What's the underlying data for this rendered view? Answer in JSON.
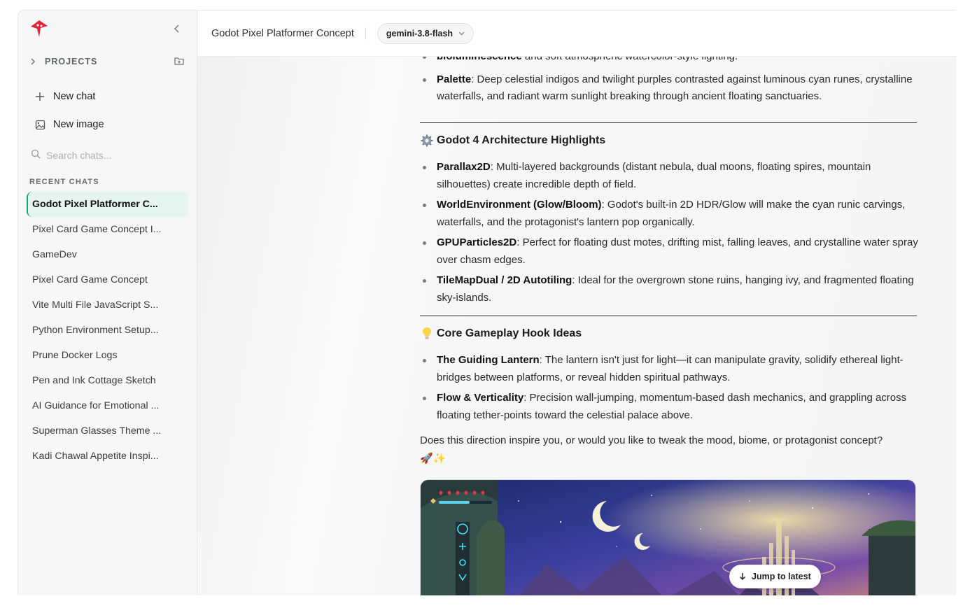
{
  "app": {
    "brand_color": "#e0253a",
    "accent": "#1aa37a"
  },
  "sidebar": {
    "projects_label": "PROJECTS",
    "new_chat": "New chat",
    "new_image": "New image",
    "search_placeholder": "Search chats...",
    "recent_label": "RECENT CHATS",
    "chats": [
      "Godot Pixel Platformer C...",
      "Pixel Card Game Concept I...",
      "GameDev",
      "Pixel Card Game Concept",
      "Vite Multi File JavaScript S...",
      "Python Environment Setup...",
      "Prune Docker Logs",
      "Pen and Ink Cottage Sketch",
      "AI Guidance for Emotional ...",
      "Superman Glasses Theme ...",
      "Kadi Chawal Appetite Inspi..."
    ]
  },
  "header": {
    "title": "Godot Pixel Platformer Concept",
    "model": "gemini-3.8-flash"
  },
  "message": {
    "cut_top_bold": "bioluminescence",
    "cut_top_rest": " and soft atmospheric watercolor-style lighting.",
    "palette_bold": "Palette",
    "palette_text": ": Deep celestial indigos and twilight purples contrasted against luminous cyan runes, crystalline waterfalls, and radiant warm sunlight breaking through ancient floating sanctuaries.",
    "arch_heading": "Godot 4 Architecture Highlights",
    "arch_items": [
      {
        "bold": "Parallax2D",
        "text": ": Multi-layered backgrounds (distant nebula, dual moons, floating spires, mountain silhouettes) create incredible depth of field."
      },
      {
        "bold": "WorldEnvironment (Glow/Bloom)",
        "text": ": Godot's built-in 2D HDR/Glow will make the cyan runic carvings, waterfalls, and the protagonist's lantern pop organically."
      },
      {
        "bold": "GPUParticles2D",
        "text": ": Perfect for floating dust motes, drifting mist, falling leaves, and crystalline water spray over chasm edges."
      },
      {
        "bold": "TileMapDual / 2D Autotiling",
        "text": ": Ideal for the overgrown stone ruins, hanging ivy, and fragmented floating sky-islands."
      }
    ],
    "hook_heading": "Core Gameplay Hook Ideas",
    "hook_items": [
      {
        "bold": "The Guiding Lantern",
        "text": ": The lantern isn't just for light—it can manipulate gravity, solidify ethereal light-bridges between platforms, or reveal hidden spiritual pathways."
      },
      {
        "bold": "Flow & Verticality",
        "text": ": Precision wall-jumping, momentum-based dash mechanics, and grappling across floating tether-points toward the celestial palace above."
      }
    ],
    "closing": "Does this direction inspire you, or would you like to tweak the mood, biome, or protagonist concept?",
    "closing_emoji": "🚀✨"
  },
  "jump_label": "Jump to latest"
}
